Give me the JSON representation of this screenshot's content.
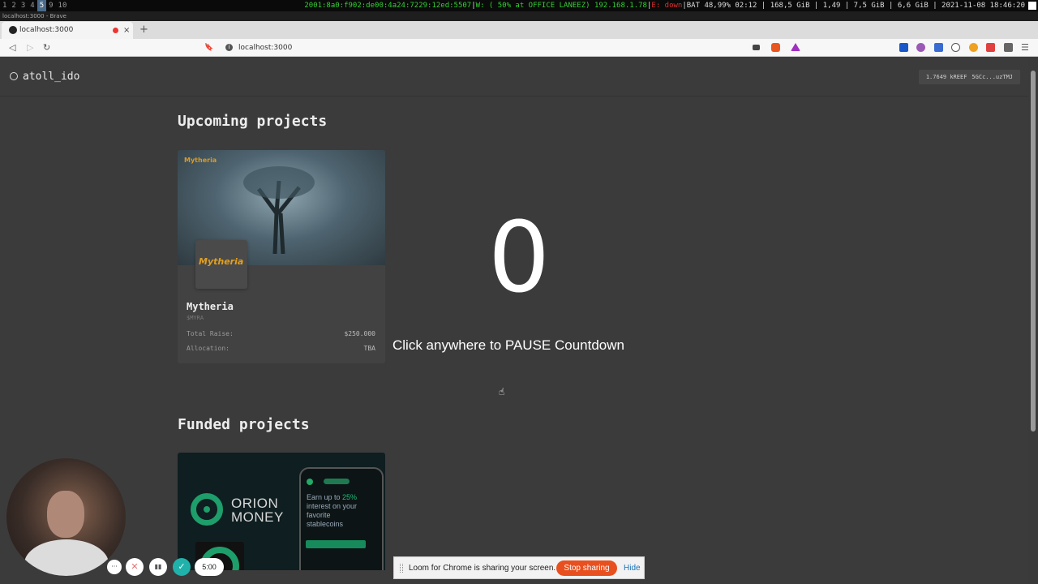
{
  "sysbar": {
    "workspaces": [
      "1",
      "2",
      "3",
      "4",
      "5",
      "9",
      "10"
    ],
    "active_workspace": "5",
    "network": "2001:8a0:f902:de00:4a24:7229:12ed:5507",
    "wifi": "W: ( 50% at OFFICE LANEEZ) 192.168.1.78",
    "eth": "E: down",
    "stats": "BAT 48,99% 02:12 | 168,5 GiB | 1,49 | 7,5 GiB | 6,6 GiB | 2021-11-08 18:46:20"
  },
  "window_title": "localhost:3000 - Brave",
  "browser": {
    "tab_title": "localhost:3000",
    "tab_close": "×",
    "new_tab": "+",
    "url": "localhost:3000",
    "info_glyph": "i",
    "back_glyph": "◁",
    "forward_glyph": "▷",
    "reload_glyph": "↻",
    "bookmark_glyph": "🔖",
    "menu_glyph": "☰"
  },
  "app": {
    "logo_text": "atoll_ido",
    "wallet_balance": "1.7649 kREEF",
    "wallet_address": "5GCc...uzTMJ"
  },
  "upcoming": {
    "title": "Upcoming projects",
    "card": {
      "tag": "Mytheria",
      "logo_text": "Mytheria",
      "name": "Mytheria",
      "ticker": "$MYRA",
      "total_raise_label": "Total Raise:",
      "total_raise_value": "$250.000",
      "allocation_label": "Allocation:",
      "allocation_value": "TBA"
    }
  },
  "countdown": {
    "value": "0",
    "hint": "Click anywhere to PAUSE Countdown",
    "cursor": "☝"
  },
  "funded": {
    "title": "Funded projects",
    "card": {
      "brand_line1": "ORION",
      "brand_line2": "MONEY",
      "phone_line1": "Earn up to ",
      "phone_highlight": "25%",
      "phone_line2": "interest on your",
      "phone_line3": "favorite",
      "phone_line4": "stablecoins"
    }
  },
  "loom": {
    "more": "···",
    "cancel": "✕",
    "pause": "▮▮",
    "done": "✓",
    "timer": "5:00",
    "sharing_msg": "Loom for Chrome is sharing your screen.",
    "stop_label": "Stop sharing",
    "hide_label": "Hide"
  },
  "colors": {
    "page_bg": "#3b3b3b",
    "stop_button": "#e8501f",
    "orion_green": "#1e9e6a"
  }
}
